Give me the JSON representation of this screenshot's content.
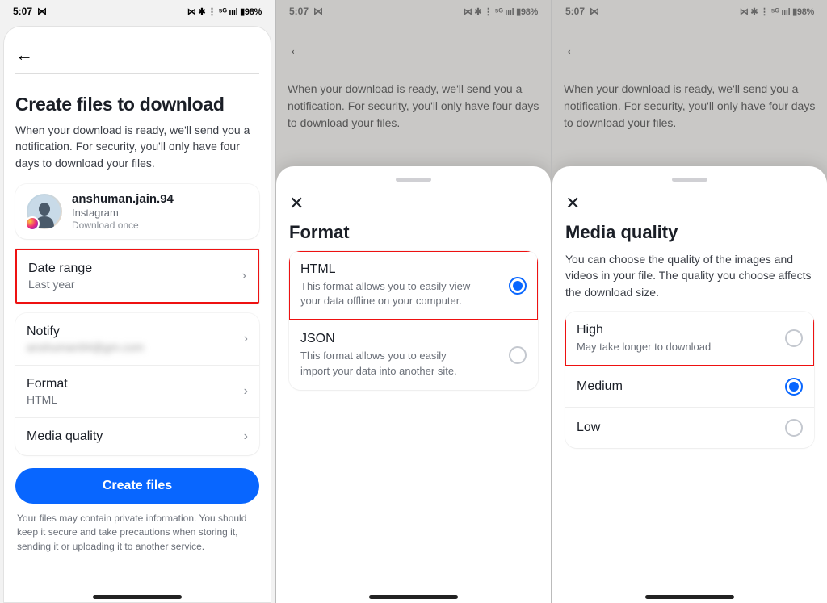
{
  "status": {
    "time": "5:07",
    "indicators": "⋈ ✱ ⋮ ⁵ᴳ ıııl ▮98%"
  },
  "screen1": {
    "title": "Create files to download",
    "subtitle": "When your download is ready, we'll send you a notification. For security, you'll only have four days to download your files.",
    "account": {
      "username": "anshuman.jain.94",
      "platform": "Instagram",
      "download_note": "Download once"
    },
    "rows": {
      "date_range": {
        "label": "Date range",
        "value": "Last year"
      },
      "notify": {
        "label": "Notify",
        "value": "anshuman94@gm.com"
      },
      "format": {
        "label": "Format",
        "value": "HTML"
      },
      "media_quality": {
        "label": "Media quality",
        "value": ""
      }
    },
    "cta": "Create files",
    "footnote": "Your files may contain private information. You should keep it secure and take precautions when storing it, sending it or uploading it to another service."
  },
  "bg_text": "When your download is ready, we'll send you a notification. For security, you'll only have four days to download your files.",
  "screen2": {
    "title": "Format",
    "options": [
      {
        "label": "HTML",
        "desc": "This format allows you to easily view your data offline on your computer.",
        "selected": true
      },
      {
        "label": "JSON",
        "desc": "This format allows you to easily import your data into another site.",
        "selected": false
      }
    ]
  },
  "screen3": {
    "title": "Media quality",
    "desc": "You can choose the quality of the images and videos in your file. The quality you choose affects the download size.",
    "options": [
      {
        "label": "High",
        "desc": "May take longer to download",
        "selected": false
      },
      {
        "label": "Medium",
        "desc": "",
        "selected": true
      },
      {
        "label": "Low",
        "desc": "",
        "selected": false
      }
    ]
  }
}
